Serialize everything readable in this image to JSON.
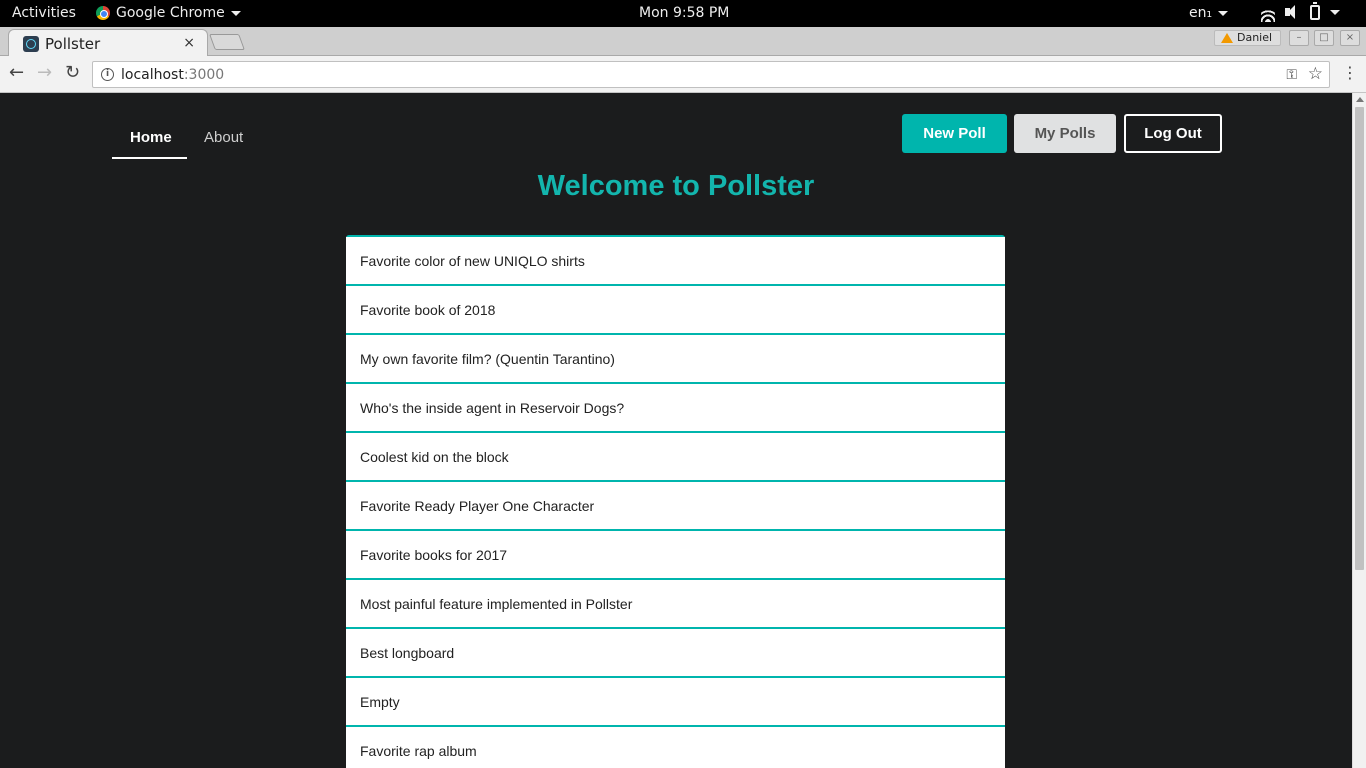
{
  "system_bar": {
    "activities": "Activities",
    "app_name": "Google Chrome",
    "clock": "Mon  9:58 PM",
    "language": "en₁"
  },
  "browser": {
    "tab_title": "Pollster",
    "tab_close": "×",
    "profile_name": "Daniel",
    "url_host": "localhost",
    "url_port": ":3000"
  },
  "nav": {
    "home": "Home",
    "about": "About"
  },
  "actions": {
    "new_poll": "New Poll",
    "my_polls": "My Polls",
    "log_out": "Log Out"
  },
  "heading": "Welcome to Pollster",
  "polls": [
    "Favorite color of new UNIQLO shirts",
    "Favorite book of 2018",
    "My own favorite film? (Quentin Tarantino)",
    "Who's the inside agent in Reservoir Dogs?",
    "Coolest kid on the block",
    "Favorite Ready Player One Character",
    "Favorite books for 2017",
    "Most painful feature implemented in Pollster",
    "Best longboard",
    "Empty",
    "Favorite rap album"
  ],
  "colors": {
    "accent": "#00b5ad",
    "background": "#1b1c1d"
  }
}
